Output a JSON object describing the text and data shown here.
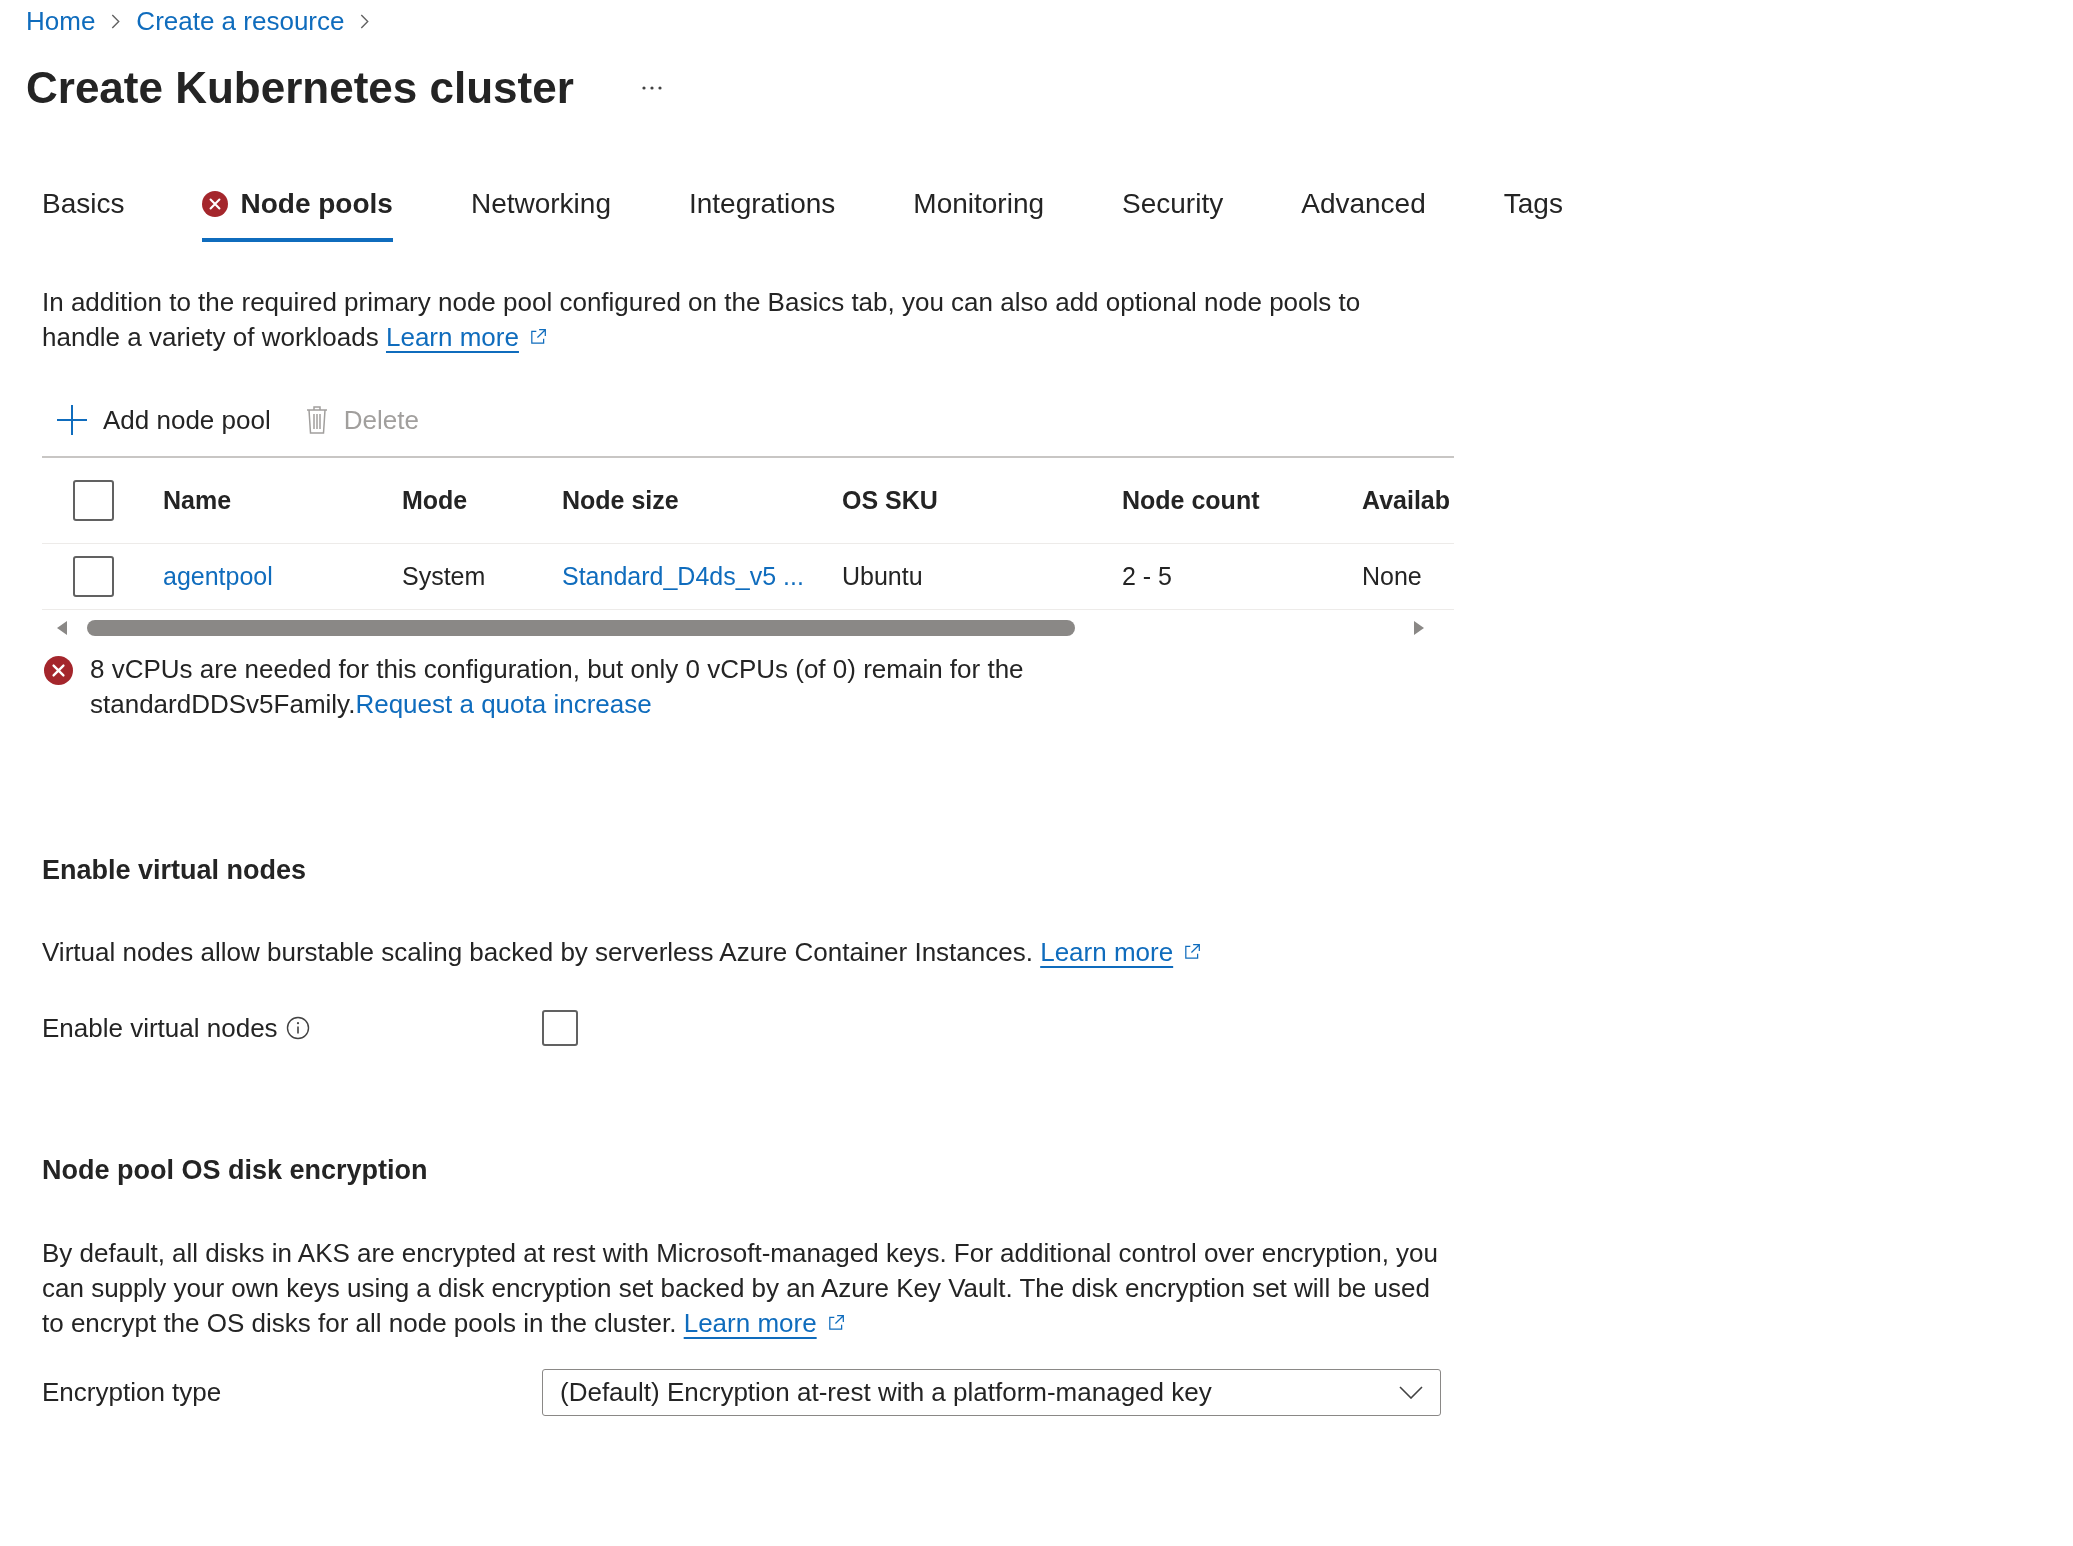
{
  "breadcrumb": [
    {
      "label": "Home"
    },
    {
      "label": "Create a resource"
    }
  ],
  "title": "Create Kubernetes cluster",
  "tabs": [
    {
      "label": "Basics",
      "selected": false,
      "error": false
    },
    {
      "label": "Node pools",
      "selected": true,
      "error": true
    },
    {
      "label": "Networking",
      "selected": false,
      "error": false
    },
    {
      "label": "Integrations",
      "selected": false,
      "error": false
    },
    {
      "label": "Monitoring",
      "selected": false,
      "error": false
    },
    {
      "label": "Security",
      "selected": false,
      "error": false
    },
    {
      "label": "Advanced",
      "selected": false,
      "error": false
    },
    {
      "label": "Tags",
      "selected": false,
      "error": false
    }
  ],
  "node_pools": {
    "intro": {
      "text": "In addition to the required primary node pool configured on the Basics tab, you can also add optional node pools to handle a variety of workloads",
      "link": "Learn more"
    },
    "toolbar": [
      {
        "kind": "add",
        "label": "Add node pool",
        "disabled": false
      },
      {
        "kind": "delete",
        "label": "Delete",
        "disabled": true
      }
    ],
    "table": {
      "header_checked": false,
      "columns": [
        "Name",
        "Mode",
        "Node size",
        "OS SKU",
        "Node count",
        "Availab"
      ],
      "rows": [
        {
          "checked": false,
          "cells": [
            {
              "kind": "link",
              "text": "agentpool"
            },
            {
              "kind": "text",
              "text": "System"
            },
            {
              "kind": "link",
              "text": "Standard_D4ds_v5 ..."
            },
            {
              "kind": "text",
              "text": "Ubuntu"
            },
            {
              "kind": "text",
              "text": "2 - 5"
            },
            {
              "kind": "text",
              "text": "None"
            }
          ]
        }
      ]
    },
    "error": {
      "text": "8 vCPUs are needed for this configuration, but only 0 vCPUs (of 0) remain for the standardDDSv5Family.",
      "link": "Request a quota increase"
    }
  },
  "virtual_nodes": {
    "heading": "Enable virtual nodes",
    "description": {
      "text": "Virtual nodes allow burstable scaling backed by serverless Azure Container Instances.",
      "link": "Learn more"
    },
    "field": {
      "label": "Enable virtual nodes",
      "checked": false
    }
  },
  "disk_encryption": {
    "heading": "Node pool OS disk encryption",
    "description": {
      "text": "By default, all disks in AKS are encrypted at rest with Microsoft-managed keys. For additional control over encryption, you can supply your own keys using a disk encryption set backed by an Azure Key Vault. The disk encryption set will be used to encrypt the OS disks for all node pools in the cluster.",
      "link": "Learn more"
    },
    "field": {
      "label": "Encryption type",
      "value": "(Default) Encryption at-rest with a platform-managed key"
    }
  }
}
